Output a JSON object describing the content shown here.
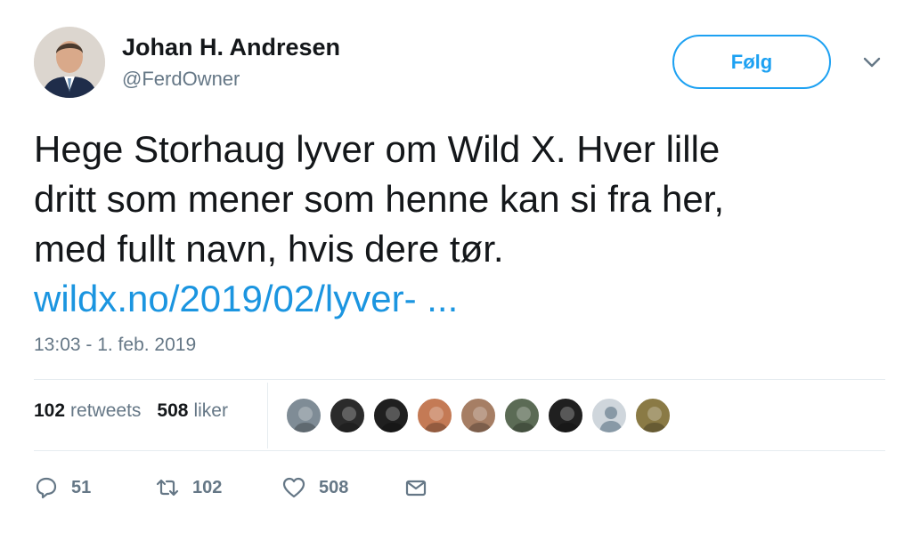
{
  "tweet": {
    "author": {
      "name": "Johan H. Andresen",
      "handle": "@FerdOwner"
    },
    "follow_label": "Følg",
    "text": "Hege Storhaug lyver om Wild X. Hver lille\ndritt som mener som henne kan si fra her,\nmed fullt navn, hvis dere tør.",
    "link": "wildx.no/2019/02/lyver- ...",
    "timestamp": "13:03 - 1. feb. 2019",
    "stats": {
      "retweets_count": "102",
      "retweets_label": "retweets",
      "likes_count": "508",
      "likes_label": "liker"
    },
    "likers": [
      {
        "icon": "liker-avatar-1",
        "color": "#7f8c96"
      },
      {
        "icon": "liker-avatar-2",
        "color": "#2b2b2b"
      },
      {
        "icon": "liker-avatar-3",
        "color": "#1f1f1f"
      },
      {
        "icon": "liker-avatar-4",
        "color": "#c47a55"
      },
      {
        "icon": "liker-avatar-5",
        "color": "#a67e64"
      },
      {
        "icon": "liker-avatar-6",
        "color": "#5b6b55"
      },
      {
        "icon": "liker-avatar-7",
        "color": "#202020"
      },
      {
        "icon": "liker-avatar-default",
        "color": "#cfd6dc"
      },
      {
        "icon": "liker-avatar-9",
        "color": "#8a7a45"
      }
    ],
    "actions": {
      "replies": "51",
      "retweets": "102",
      "likes": "508"
    }
  },
  "colors": {
    "accent": "#1da1f2",
    "link": "#1b95e0",
    "secondary_text": "#657786",
    "divider": "#e6ecf0"
  }
}
